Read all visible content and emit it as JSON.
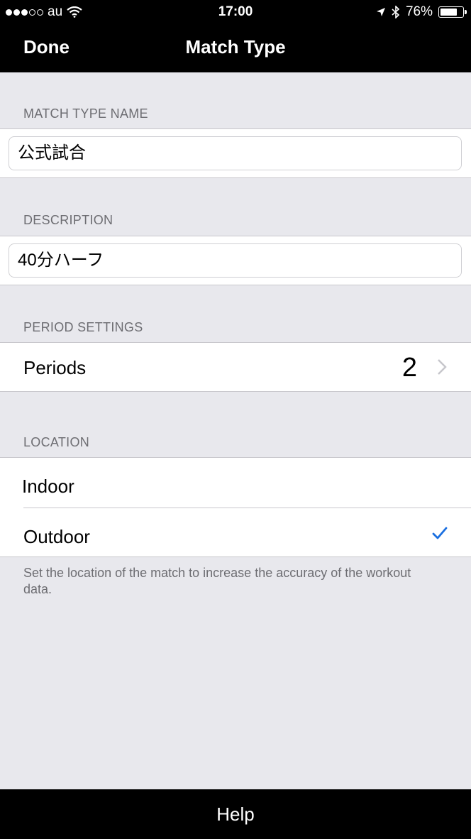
{
  "status_bar": {
    "carrier": "au",
    "time": "17:00",
    "battery": "76%",
    "battery_level": 0.76,
    "signal_bars_filled": 3,
    "signal_bars_total": 5
  },
  "nav": {
    "done_label": "Done",
    "title": "Match Type"
  },
  "sections": {
    "name_header": "MATCH TYPE NAME",
    "name_value": "公式試合",
    "description_header": "DESCRIPTION",
    "description_value": "40分ハーフ",
    "period_header": "PERIOD SETTINGS",
    "periods_label": "Periods",
    "periods_value": "2",
    "location_header": "LOCATION",
    "location_options": [
      {
        "label": "Indoor",
        "selected": false
      },
      {
        "label": "Outdoor",
        "selected": true
      }
    ],
    "location_note": "Set the location of the match to increase the accuracy of the workout data."
  },
  "toolbar": {
    "help_label": "Help"
  },
  "colors": {
    "accent": "#1a6fe0",
    "background": "#e8e8ed",
    "secondary_text": "#6d6d72"
  },
  "icons": [
    "wifi-icon",
    "location-arrow-icon",
    "bluetooth-icon",
    "battery-icon",
    "chevron-right-icon",
    "checkmark-icon"
  ]
}
